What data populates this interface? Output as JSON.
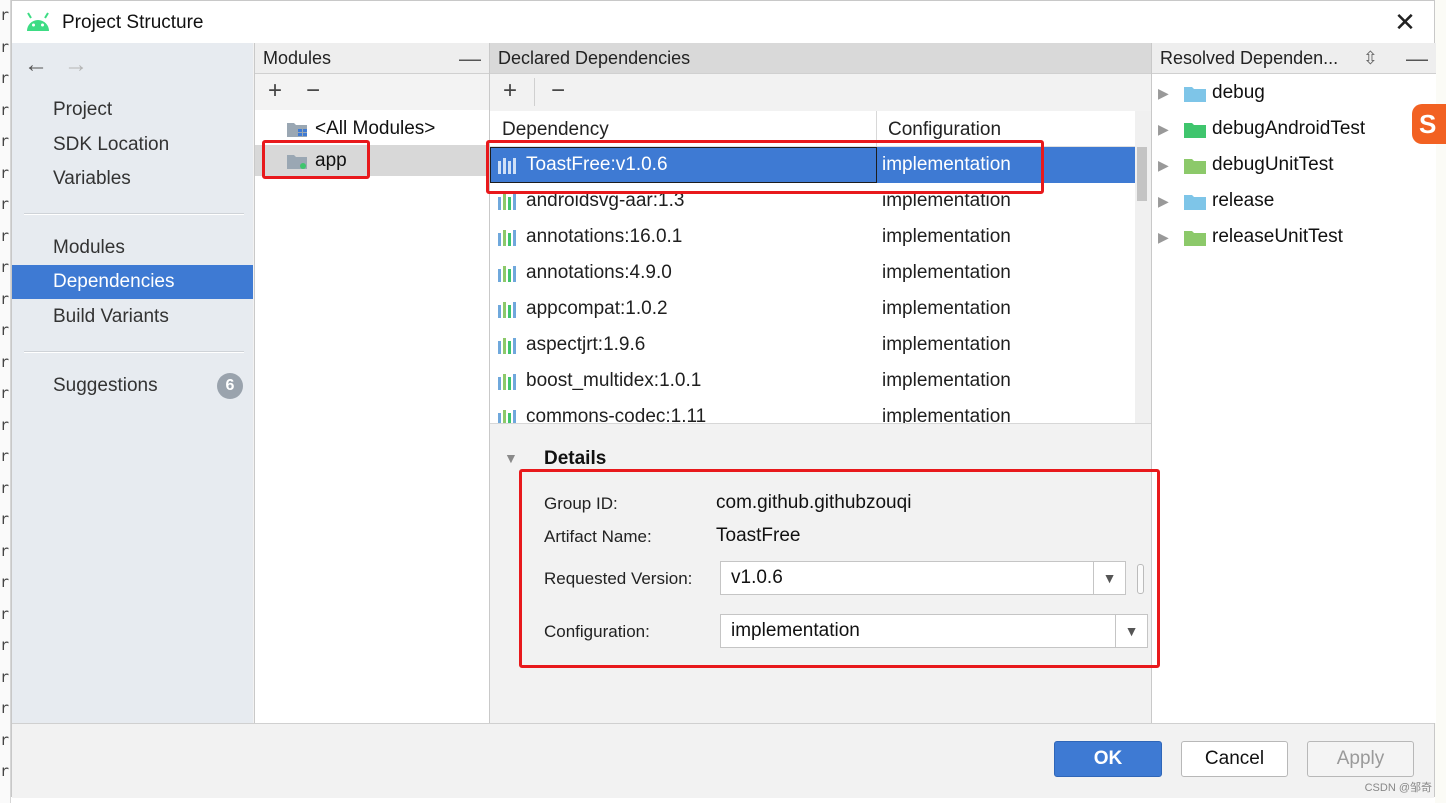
{
  "window": {
    "title": "Project Structure",
    "close_label": "✕"
  },
  "nav": {
    "back_label": "←",
    "forward_label": "→",
    "items": [
      {
        "label": "Project"
      },
      {
        "label": "SDK Location"
      },
      {
        "label": "Variables"
      },
      {
        "label": "Modules"
      },
      {
        "label": "Dependencies",
        "selected": true
      },
      {
        "label": "Build Variants"
      },
      {
        "label": "Suggestions",
        "badge": "6"
      }
    ]
  },
  "modules": {
    "header": "Modules",
    "add_label": "+",
    "remove_label": "−",
    "items": [
      {
        "label": "<All Modules>",
        "icon": "module-group-icon"
      },
      {
        "label": "app",
        "icon": "app-module-icon",
        "selected": true
      }
    ]
  },
  "dependencies": {
    "header": "Declared Dependencies",
    "add_label": "+",
    "remove_label": "−",
    "columns": [
      "Dependency",
      "Configuration"
    ],
    "rows": [
      {
        "name": "ToastFree:v1.0.6",
        "configuration": "implementation",
        "selected": true
      },
      {
        "name": "androidsvg-aar:1.3",
        "configuration": "implementation"
      },
      {
        "name": "annotations:16.0.1",
        "configuration": "implementation"
      },
      {
        "name": "annotations:4.9.0",
        "configuration": "implementation"
      },
      {
        "name": "appcompat:1.0.2",
        "configuration": "implementation"
      },
      {
        "name": "aspectjrt:1.9.6",
        "configuration": "implementation"
      },
      {
        "name": "boost_multidex:1.0.1",
        "configuration": "implementation"
      },
      {
        "name": "commons-codec:1.11",
        "configuration": "implementation"
      }
    ]
  },
  "details": {
    "title": "Details",
    "group_id_label": "Group ID:",
    "group_id": "com.github.githubzouqi",
    "artifact_label": "Artifact Name:",
    "artifact": "ToastFree",
    "version_label": "Requested Version:",
    "version": "v1.0.6",
    "configuration_label": "Configuration:",
    "configuration": "implementation"
  },
  "resolved": {
    "header": "Resolved Dependen...",
    "items": [
      {
        "label": "debug",
        "color": "#7ec5e8"
      },
      {
        "label": "debugAndroidTest",
        "color": "#3fc56d"
      },
      {
        "label": "debugUnitTest",
        "color": "#8cc96a"
      },
      {
        "label": "release",
        "color": "#7ec5e8"
      },
      {
        "label": "releaseUnitTest",
        "color": "#8cc96a"
      }
    ]
  },
  "buttons": {
    "ok": "OK",
    "cancel": "Cancel",
    "apply": "Apply"
  },
  "colors": {
    "accent": "#3e7ad3",
    "annotation": "#e8191c",
    "android_green": "#3ddc84"
  },
  "watermark": "CSDN @邹奇"
}
